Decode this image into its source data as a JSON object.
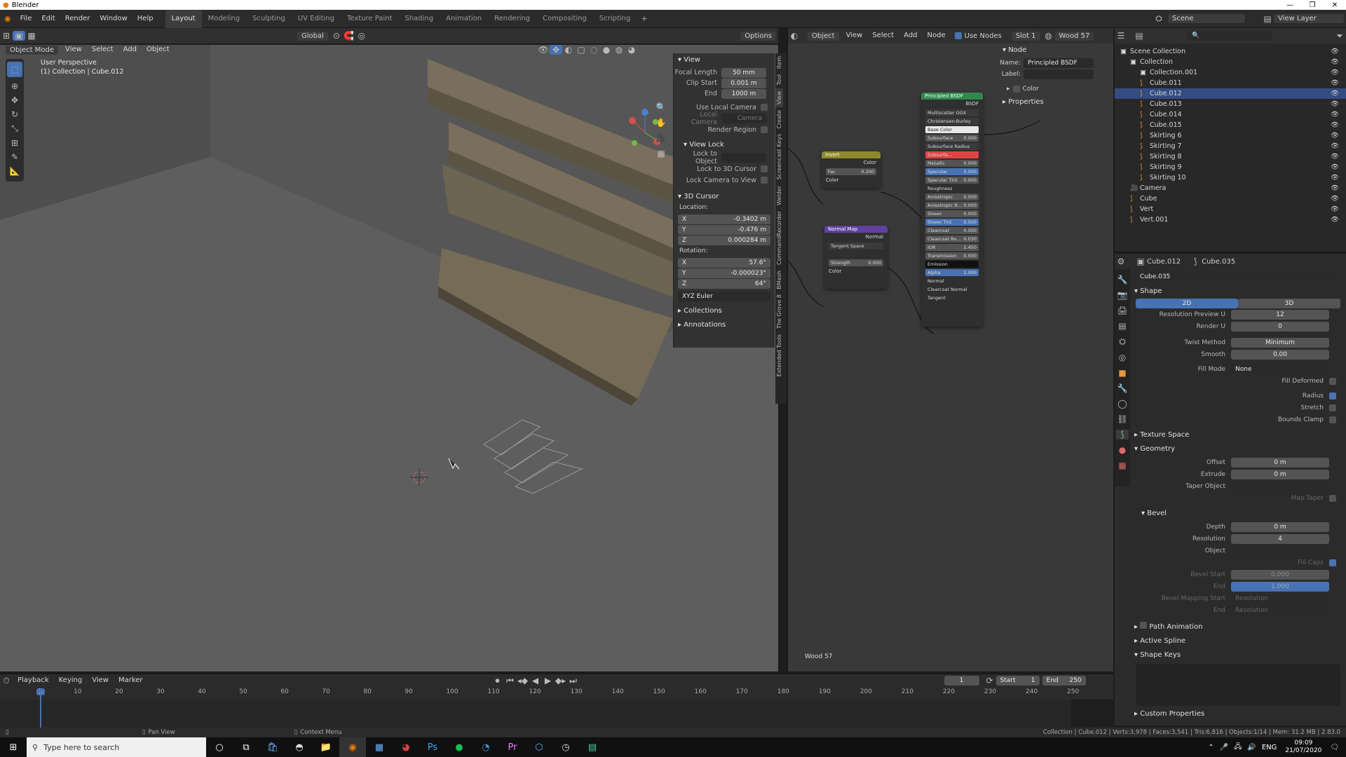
{
  "window": {
    "title": "Blender"
  },
  "menu": [
    "File",
    "Edit",
    "Render",
    "Window",
    "Help"
  ],
  "workspaces": [
    "Layout",
    "Modeling",
    "Sculpting",
    "UV Editing",
    "Texture Paint",
    "Shading",
    "Animation",
    "Rendering",
    "Compositing",
    "Scripting"
  ],
  "workspace_active": "Layout",
  "header3d": {
    "transform": "Global",
    "options": "Options",
    "mode": "Object Mode",
    "menus": [
      "View",
      "Select",
      "Add",
      "Object"
    ]
  },
  "viewport": {
    "perspective": "User Perspective",
    "collection_info": "(1) Collection | Cube.012"
  },
  "npanel": {
    "view": {
      "title": "View",
      "focal_label": "Focal Length",
      "focal": "50 mm",
      "clip_start_label": "Clip Start",
      "clip_start": "0.001 m",
      "end_label": "End",
      "end": "1000 m",
      "use_local_camera": "Use Local Camera",
      "local_camera": "Local Camera",
      "camera": "Camera",
      "render_region": "Render Region"
    },
    "view_lock": {
      "title": "View Lock",
      "lock_object": "Lock to Object",
      "lock_cursor": "Lock to 3D Cursor",
      "lock_camera": "Lock Camera to View"
    },
    "cursor": {
      "title": "3D Cursor",
      "location": "Location:",
      "x_label": "X",
      "x": "-0.3402 m",
      "y_label": "Y",
      "y": "-0.476 m",
      "z_label": "Z",
      "z": "0.000284 m",
      "rotation": "Rotation:",
      "rx": "57.6°",
      "ry": "-0.000023°",
      "rz": "64°",
      "euler": "XYZ Euler"
    },
    "collections": "Collections",
    "annotations": "Annotations",
    "tabs": [
      "Item",
      "Tool",
      "View",
      "Create",
      "Screencast Keys",
      "Welder",
      "CommandRecorder",
      "BMesh",
      "The Grove 8",
      "Extended Tools"
    ]
  },
  "node_editor": {
    "header": {
      "object": "Object",
      "menus": [
        "View",
        "Select",
        "Add",
        "Node"
      ],
      "use_nodes": "Use Nodes",
      "slot": "Slot 1",
      "material": "Wood 57"
    },
    "material_label": "Wood 57",
    "sidebar": {
      "node": "Node",
      "name": "Principled BSDF",
      "label": "Label:",
      "color": "Color",
      "properties": "Properties"
    },
    "invert": {
      "title": "Invert",
      "color_out": "Color",
      "fac_label": "Fac",
      "fac": "0.200",
      "color_in": "Color"
    },
    "normal_map": {
      "title": "Normal Map",
      "normal": "Normal",
      "space": "Tangent Space",
      "strength_label": "Strength",
      "strength": "0.000",
      "color": "Color"
    },
    "bsdf": {
      "title": "Principled BSDF",
      "output": "BSDF",
      "dist": "Multiscatter GGX",
      "sss_method": "Christensen-Burley",
      "inputs": [
        {
          "label": "Base Color",
          "value": "",
          "kind": "white"
        },
        {
          "label": "Subsurface",
          "value": "0.000",
          "kind": "field"
        },
        {
          "label": "Subsurface Radius",
          "value": "",
          "kind": "dropdown"
        },
        {
          "label": "Subsurfa...",
          "value": "",
          "kind": "red"
        },
        {
          "label": "Metallic",
          "value": "0.000",
          "kind": "field"
        },
        {
          "label": "Specular",
          "value": "0.500",
          "kind": "blue"
        },
        {
          "label": "Specular Tint",
          "value": "0.000",
          "kind": "field"
        },
        {
          "label": "Roughness",
          "value": "",
          "kind": "plain"
        },
        {
          "label": "Anisotropic",
          "value": "0.000",
          "kind": "field"
        },
        {
          "label": "Anisotropic R...",
          "value": "0.000",
          "kind": "field"
        },
        {
          "label": "Sheen",
          "value": "0.000",
          "kind": "field"
        },
        {
          "label": "Sheen Tint",
          "value": "0.500",
          "kind": "blue"
        },
        {
          "label": "Clearcoat",
          "value": "0.000",
          "kind": "field"
        },
        {
          "label": "Clearcoat Ro...",
          "value": "0.030",
          "kind": "field"
        },
        {
          "label": "IOR",
          "value": "1.450",
          "kind": "field"
        },
        {
          "label": "Transmission",
          "value": "0.000",
          "kind": "field"
        },
        {
          "label": "Emission",
          "value": "",
          "kind": "black"
        },
        {
          "label": "Alpha",
          "value": "1.000",
          "kind": "blue"
        },
        {
          "label": "Normal",
          "value": "",
          "kind": "plain"
        },
        {
          "label": "Clearcoat Normal",
          "value": "",
          "kind": "plain"
        },
        {
          "label": "Tangent",
          "value": "",
          "kind": "plain"
        }
      ]
    }
  },
  "outliner": {
    "scene": "Scene",
    "view_layer": "View Layer",
    "items": [
      {
        "name": "Scene Collection",
        "depth": 0,
        "sel": false
      },
      {
        "name": "Collection",
        "depth": 1,
        "sel": false
      },
      {
        "name": "Collection.001",
        "depth": 2,
        "sel": false
      },
      {
        "name": "Cube.011",
        "depth": 2,
        "sel": false
      },
      {
        "name": "Cube.012",
        "depth": 2,
        "sel": true
      },
      {
        "name": "Cube.013",
        "depth": 2,
        "sel": false
      },
      {
        "name": "Cube.014",
        "depth": 2,
        "sel": false
      },
      {
        "name": "Cube.015",
        "depth": 2,
        "sel": false
      },
      {
        "name": "Skirting 6",
        "depth": 2,
        "sel": false
      },
      {
        "name": "Skirting 7",
        "depth": 2,
        "sel": false
      },
      {
        "name": "Skirting 8",
        "depth": 2,
        "sel": false
      },
      {
        "name": "Skirting 9",
        "depth": 2,
        "sel": false
      },
      {
        "name": "Skirting 10",
        "depth": 2,
        "sel": false
      },
      {
        "name": "Camera",
        "depth": 1,
        "sel": false
      },
      {
        "name": "Cube",
        "depth": 1,
        "sel": false
      },
      {
        "name": "Vert",
        "depth": 1,
        "sel": false
      },
      {
        "name": "Vert.001",
        "depth": 1,
        "sel": false
      }
    ]
  },
  "properties": {
    "object": "Cube.012",
    "data": "Cube.035",
    "data_field": "Cube.035",
    "shape": "Shape",
    "mode_2d": "2D",
    "mode_3d": "3D",
    "rows1": [
      {
        "label": "Resolution Preview U",
        "value": "12"
      },
      {
        "label": "Render U",
        "value": "0"
      }
    ],
    "rows2": [
      {
        "label": "Twist Method",
        "value": "Minimum"
      },
      {
        "label": "Smooth",
        "value": "0.00"
      }
    ],
    "fill_mode_label": "Fill Mode",
    "fill_mode": "None",
    "fill_deformed": "Fill Deformed",
    "radius": "Radius",
    "stretch": "Stretch",
    "bounds_clamp": "Bounds Clamp",
    "texture_space": "Texture Space",
    "geometry": "Geometry",
    "offset_label": "Offset",
    "offset": "0 m",
    "extrude_label": "Extrude",
    "extrude": "0 m",
    "taper_label": "Taper Object",
    "map_taper": "Map Taper",
    "bevel": "Bevel",
    "depth_label": "Depth",
    "depth": "0 m",
    "res_label": "Resolution",
    "res": "4",
    "object_label": "Object",
    "fill_caps": "Fill Caps",
    "bevel_start_label": "Bevel Start",
    "bevel_start": "0.000",
    "end_label": "End",
    "end": "1.000",
    "mapping_start_label": "Bevel Mapping Start",
    "mapping_start": "Resolution",
    "mapping_end_label": "End",
    "mapping_end": "Resolution",
    "path_animation": "Path Animation",
    "active_spline": "Active Spline",
    "shape_keys": "Shape Keys",
    "custom_props": "Custom Properties"
  },
  "timeline": {
    "menus": [
      "Playback",
      "Keying",
      "View",
      "Marker"
    ],
    "current_frame": "1",
    "start_label": "Start",
    "start": "1",
    "end_label": "End",
    "end": "250",
    "ticks": [
      "1",
      "10",
      "20",
      "30",
      "40",
      "50",
      "60",
      "70",
      "80",
      "90",
      "100",
      "110",
      "120",
      "130",
      "140",
      "150",
      "160",
      "170",
      "180",
      "190",
      "200",
      "210",
      "220",
      "230",
      "240",
      "250"
    ]
  },
  "statusbar": {
    "pan": "Pan View",
    "context": "Context Menu",
    "stats": "Collection | Cube.012 | Verts:3,978 | Faces:3,541 | Tris:6,816 | Objects:1/14 | Mem: 31.2 MB | 2.83.0"
  },
  "taskbar": {
    "search": "Type here to search",
    "lang": "ENG",
    "time": "09:09",
    "date": "21/07/2020"
  }
}
